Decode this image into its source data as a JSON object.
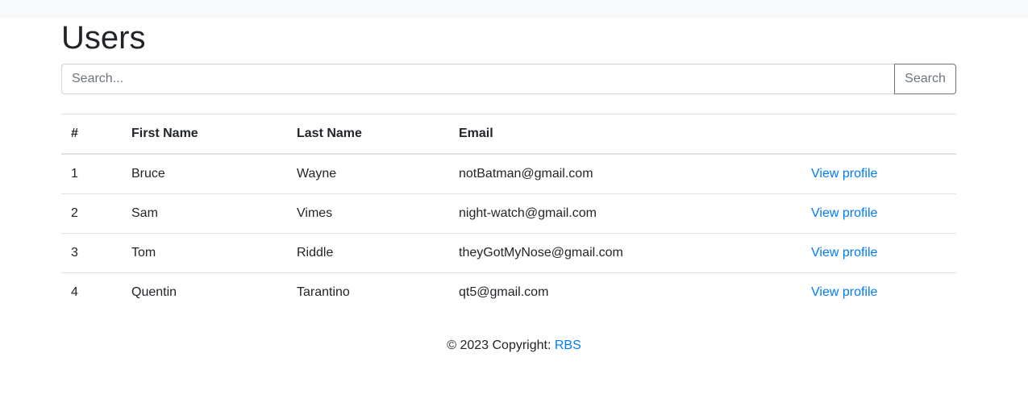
{
  "page": {
    "title": "Users"
  },
  "search": {
    "placeholder": "Search...",
    "button_label": "Search"
  },
  "table": {
    "headers": [
      "#",
      "First Name",
      "Last Name",
      "Email",
      ""
    ],
    "rows": [
      {
        "id": "1",
        "first_name": "Bruce",
        "last_name": "Wayne",
        "email": "notBatman@gmail.com",
        "action": "View profile"
      },
      {
        "id": "2",
        "first_name": "Sam",
        "last_name": "Vimes",
        "email": "night-watch@gmail.com",
        "action": "View profile"
      },
      {
        "id": "3",
        "first_name": "Tom",
        "last_name": "Riddle",
        "email": "theyGotMyNose@gmail.com",
        "action": "View profile"
      },
      {
        "id": "4",
        "first_name": "Quentin",
        "last_name": "Tarantino",
        "email": "qt5@gmail.com",
        "action": "View profile"
      }
    ]
  },
  "footer": {
    "copyright_text": "© 2023 Copyright: ",
    "brand_link": "RBS"
  },
  "colors": {
    "link": "#007bff",
    "topbar": "#f8f9fa",
    "text": "#212529",
    "border": "#dee2e6"
  }
}
